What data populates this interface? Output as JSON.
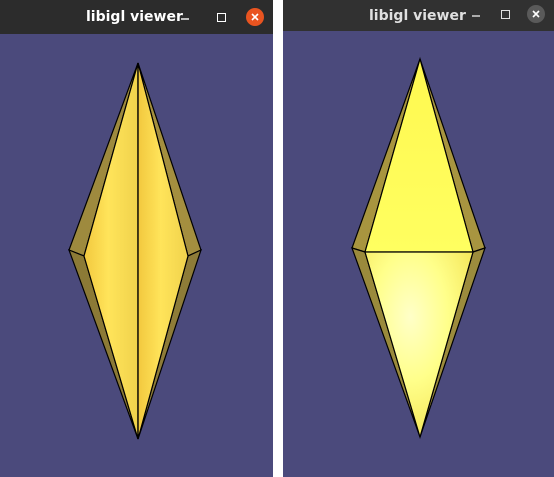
{
  "windows": [
    {
      "title": "libigl viewer",
      "controls": {
        "minimize_icon": "minimize-icon",
        "maximize_icon": "maximize-icon",
        "close_icon": "close-icon"
      },
      "close_color": "#e95420",
      "viewport_background": "#4b4a7c",
      "mesh": "bipyramid-yellow-front-edge"
    },
    {
      "title": "libigl viewer",
      "controls": {
        "minimize_icon": "minimize-icon",
        "maximize_icon": "maximize-icon",
        "close_icon": "close-icon"
      },
      "close_color": "#5a5a5a",
      "viewport_background": "#4b4a7c",
      "mesh": "bipyramid-yellow-front-face"
    }
  ],
  "colors": {
    "titlebar": "#2c2c2c",
    "mesh_light": "#ffff60",
    "mesh_mid": "#f5d94a",
    "mesh_shadow": "#8c7a3a",
    "edge": "#000000"
  }
}
